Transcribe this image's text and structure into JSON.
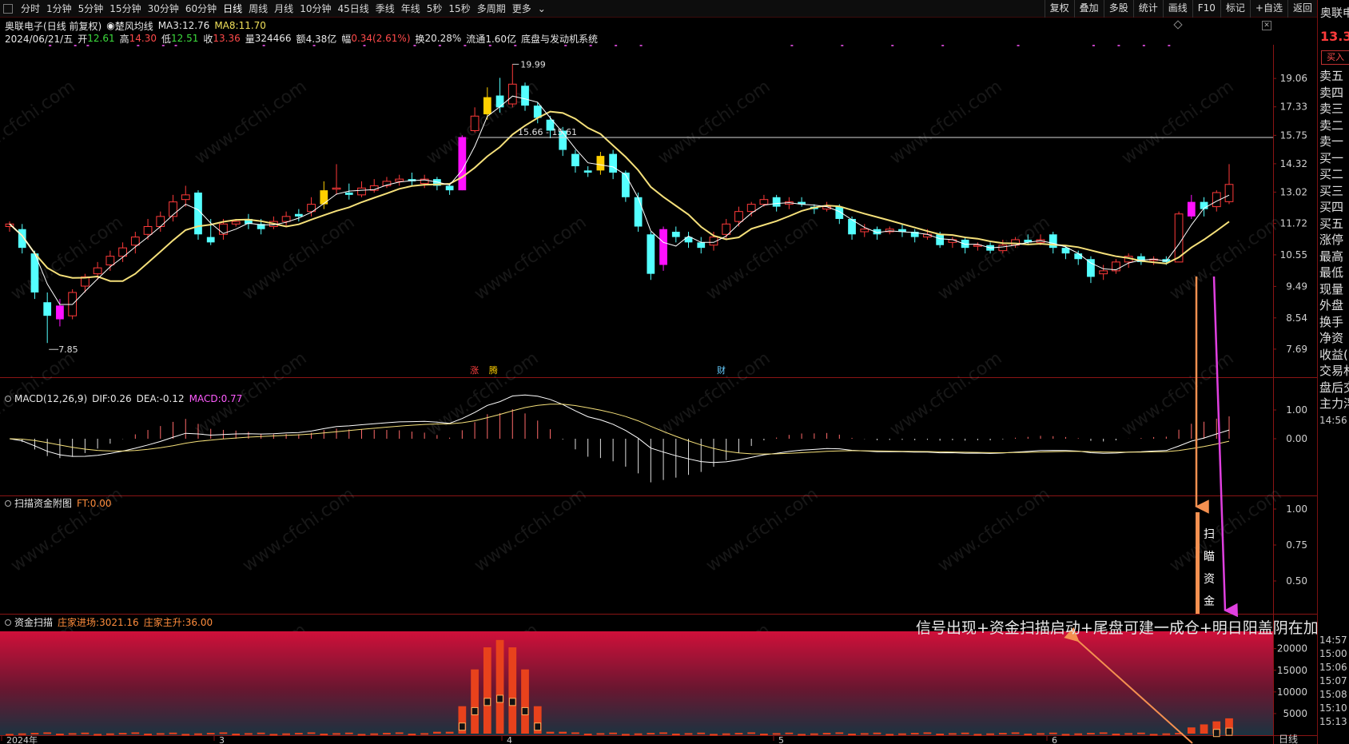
{
  "toolbar": {
    "periods": [
      "分时",
      "1分钟",
      "5分钟",
      "15分钟",
      "30分钟",
      "60分钟",
      "日线",
      "周线",
      "月线",
      "10分钟",
      "45日线",
      "季线",
      "年线",
      "5秒",
      "15秒",
      "多周期",
      "更多"
    ],
    "more_arrow": "⌄",
    "right_buttons": [
      "复权",
      "叠加",
      "多股",
      "统计",
      "画线",
      "F10",
      "标记",
      "+自选",
      "返回"
    ]
  },
  "header": {
    "stock": "奥联电子",
    "mode": "(日线 前复权)",
    "indicator_name": "楚风均线",
    "ma3_label": "MA3:",
    "ma3_value": "12.76",
    "ma8_label": "MA8:",
    "ma8_value": "11.70",
    "date": "2024/06/21/五",
    "open_label": "开",
    "open_value": "12.61",
    "high_label": "高",
    "high_value": "14.30",
    "low_label": "低",
    "low_value": "12.51",
    "close_label": "收",
    "close_value": "13.36",
    "vol_label": "量",
    "vol_value": "324466",
    "amt_label": "额",
    "amt_value": "4.38亿",
    "chg_label": "幅",
    "chg_value": "0.34(2.61%)",
    "turnover_label": "换",
    "turnover_value": "20.28%",
    "float_label": "流通",
    "float_value": "1.60亿",
    "system_label": "底盘与发动机系统"
  },
  "right_panel": {
    "name": "奥联申",
    "price": "13.3",
    "buy_button": "买入",
    "rows": [
      "卖五",
      "卖四",
      "卖三",
      "卖二",
      "卖一",
      "买一",
      "买二",
      "买三",
      "买四",
      "买五",
      "涨停",
      "最高",
      "最低",
      "现量",
      "外盘",
      "换手",
      "净资",
      "收益(",
      "交易札",
      "盘后交",
      "主力浮"
    ],
    "times": [
      "14:56",
      "14:57",
      "15:00",
      "15:06",
      "15:07",
      "15:08",
      "15:10",
      "15:13"
    ]
  },
  "panes": {
    "price": {
      "y_ticks": [
        "19.06",
        "17.33",
        "15.75",
        "14.32",
        "13.02",
        "11.72",
        "10.55",
        "9.49",
        "8.54",
        "7.69"
      ],
      "annotations": {
        "peak": "19.99",
        "low": "7.85",
        "hline": "15.66 - 15.61"
      },
      "markers": [
        "涨",
        "腾",
        "财"
      ]
    },
    "macd": {
      "title": "MACD(12,26,9)",
      "dif_label": "DIF:",
      "dif_value": "0.26",
      "dea_label": "DEA:",
      "dea_value": "-0.12",
      "macd_label": "MACD:",
      "macd_value": "0.77",
      "y_ticks": [
        "1.00",
        "0.00"
      ]
    },
    "scan": {
      "title": "扫描资金附图",
      "ft_label": "FT:",
      "ft_value": "0.00",
      "y_ticks": [
        "1.00",
        "0.75",
        "0.50"
      ],
      "vertical_label": [
        "扫",
        "瞄",
        "资",
        "金"
      ]
    },
    "fund": {
      "title": "资金扫描",
      "enter_label": "庄家进场:",
      "enter_value": "3021.16",
      "rise_label": "庄家主升:",
      "rise_value": "36.00",
      "y_ticks": [
        "20000",
        "15000",
        "10000",
        "5000"
      ]
    }
  },
  "x_axis": {
    "labels": [
      "2024年",
      "3",
      "4",
      "5",
      "6"
    ],
    "period": "日线"
  },
  "annotation_text": "信号出现+资金扫描启动+尾盘可建一成仓+明日阳盖阴在加仓",
  "watermark": "www.cfchi.com",
  "colors": {
    "up": "#ff2020",
    "down": "#54ffff",
    "ma_short": "#ffffff",
    "ma_long": "#f5e07a",
    "signal_pink": "#ff00ff",
    "signal_yellow": "#ffd000",
    "orange_arrow": "#f49050",
    "magenta_arrow": "#e040e0"
  }
}
